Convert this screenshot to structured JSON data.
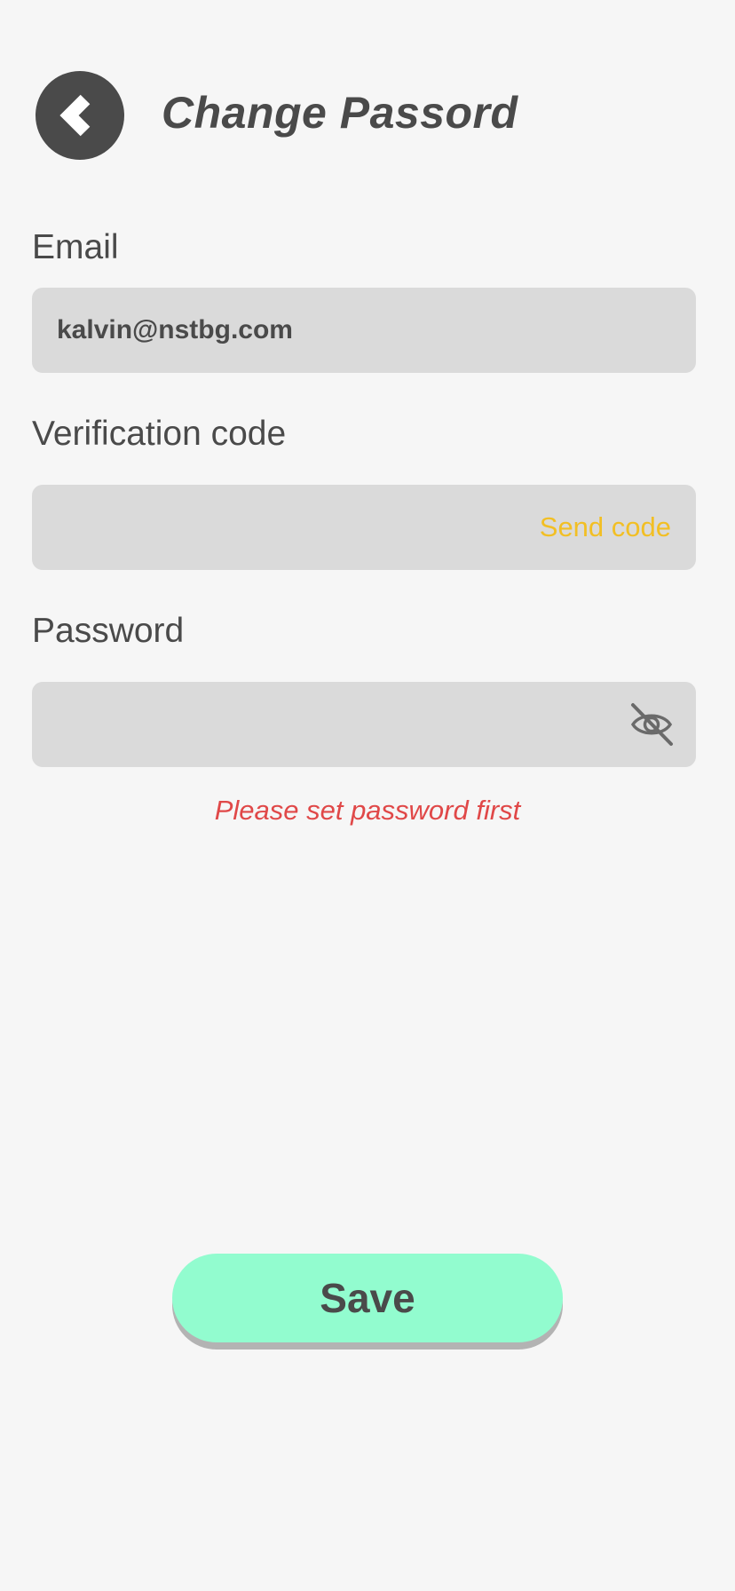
{
  "header": {
    "back_icon": "chevron-left-icon",
    "title": "Change Passord"
  },
  "form": {
    "email": {
      "label": "Email",
      "value": "kalvin@nstbg.com"
    },
    "verification": {
      "label": "Verification code",
      "value": "",
      "send_code_label": "Send code"
    },
    "password": {
      "label": "Password",
      "value": "",
      "toggle_icon": "eye-off-icon"
    },
    "error_message": "Please set password first"
  },
  "actions": {
    "save_label": "Save"
  },
  "colors": {
    "background": "#f6f6f6",
    "text": "#4a4a4a",
    "field_background": "#dadada",
    "accent_link": "#f2bf24",
    "error": "#e04848",
    "save_button": "#92fccf"
  }
}
